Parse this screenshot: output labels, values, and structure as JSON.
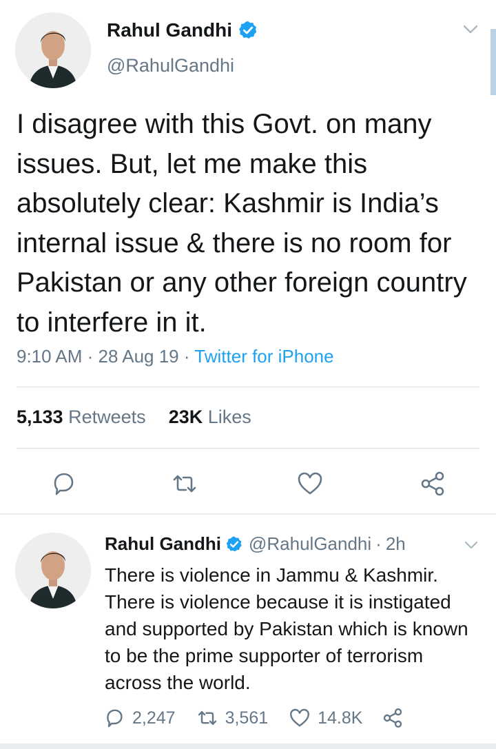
{
  "main_tweet": {
    "author": {
      "display_name": "Rahul Gandhi",
      "handle": "@RahulGandhi",
      "verified": true,
      "avatar_icon": "profile-photo"
    },
    "text": "I disagree with this Govt. on many issues. But, let me make this absolutely clear: Kashmir is India’s internal issue & there is no room for Pakistan or any other foreign country to interfere in it.",
    "time": "9:10 AM",
    "date": "28 Aug 19",
    "separator": " · ",
    "source": "Twitter for iPhone",
    "stats": {
      "retweets_count": "5,133",
      "retweets_label": "Retweets",
      "likes_count": "23K",
      "likes_label": "Likes"
    },
    "actions": [
      "reply-icon",
      "retweet-icon",
      "like-icon",
      "share-icon"
    ]
  },
  "second_tweet": {
    "author": {
      "display_name": "Rahul Gandhi",
      "handle": "@RahulGandhi",
      "verified": true
    },
    "dot": "·",
    "time": "2h",
    "text": "There is violence in Jammu & Kashmir. There is violence because it is instigated and supported by Pakistan which is known to be the prime supporter of terrorism across the world.",
    "counts": {
      "replies": "2,247",
      "retweets": "3,561",
      "likes": "14.8K"
    }
  },
  "colors": {
    "accent": "#1da1f2",
    "text_primary": "#14171a",
    "text_secondary": "#657786",
    "divider": "#e6ecf0"
  }
}
